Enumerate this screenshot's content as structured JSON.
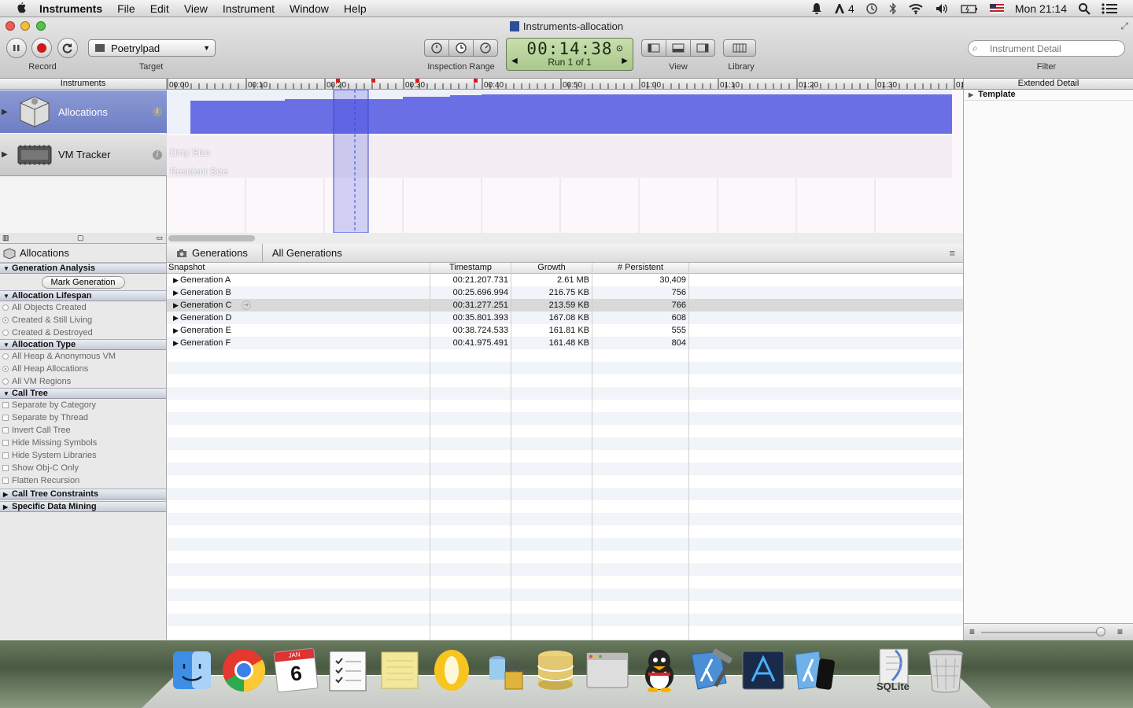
{
  "menubar": {
    "app_name": "Instruments",
    "items": [
      "File",
      "Edit",
      "View",
      "Instrument",
      "Window",
      "Help"
    ],
    "status_count": "4",
    "clock": "Mon 21:14"
  },
  "window": {
    "title": "Instruments-allocation",
    "toolbar": {
      "record_label": "Record",
      "target_label": "Target",
      "target_value": "Poetrylpad",
      "inspection_label": "Inspection Range",
      "timer": "00:14:38",
      "run": "Run 1 of 1",
      "view_label": "View",
      "library_label": "Library",
      "filter_placeholder": "Instrument Detail",
      "filter_label": "Filter"
    }
  },
  "instruments": {
    "header": "Instruments",
    "items": [
      {
        "name": "Allocations"
      },
      {
        "name": "VM Tracker"
      }
    ],
    "info_glyph": "i"
  },
  "timeline": {
    "ticks": [
      "00:00",
      "00:10",
      "00:20",
      "00:30",
      "00:40",
      "00:50",
      "01:00",
      "01:10",
      "01:20",
      "01:30",
      "01"
    ],
    "vm_labels": [
      "Dirty Size",
      "Resident Size"
    ]
  },
  "extended_detail": {
    "header": "Extended Detail",
    "template": "Template"
  },
  "left_panel": {
    "title": "Allocations",
    "sections": {
      "generation_analysis": "Generation Analysis",
      "mark_generation": "Mark Generation",
      "allocation_lifespan": "Allocation Lifespan",
      "lifespan_options": [
        "All Objects Created",
        "Created & Still Living",
        "Created & Destroyed"
      ],
      "allocation_type": "Allocation Type",
      "type_options": [
        "All Heap & Anonymous VM",
        "All Heap Allocations",
        "All VM Regions"
      ],
      "call_tree": "Call Tree",
      "call_tree_options": [
        "Separate by Category",
        "Separate by Thread",
        "Invert Call Tree",
        "Hide Missing Symbols",
        "Hide System Libraries",
        "Show Obj-C Only",
        "Flatten Recursion"
      ],
      "call_tree_constraints": "Call Tree Constraints",
      "specific_data_mining": "Specific Data Mining"
    }
  },
  "detail": {
    "breadcrumbs": [
      "Generations",
      "All Generations"
    ],
    "columns": [
      "Snapshot",
      "Timestamp",
      "Growth",
      "# Persistent"
    ],
    "rows": [
      {
        "snapshot": "Generation A",
        "timestamp": "00:21.207.731",
        "growth": "2.61 MB",
        "persistent": "30,409"
      },
      {
        "snapshot": "Generation B",
        "timestamp": "00:25.696.994",
        "growth": "216.75 KB",
        "persistent": "756"
      },
      {
        "snapshot": "Generation C",
        "timestamp": "00:31.277.251",
        "growth": "213.59 KB",
        "persistent": "766"
      },
      {
        "snapshot": "Generation D",
        "timestamp": "00:35.801.393",
        "growth": "167.08 KB",
        "persistent": "608"
      },
      {
        "snapshot": "Generation E",
        "timestamp": "00:38.724.533",
        "growth": "161.81 KB",
        "persistent": "555"
      },
      {
        "snapshot": "Generation F",
        "timestamp": "00:41.975.491",
        "growth": "161.48 KB",
        "persistent": "804"
      }
    ]
  },
  "dock": {
    "apps": [
      "finder",
      "chrome",
      "calendar",
      "reminders",
      "stickies",
      "opera",
      "keychain",
      "sequel",
      "browser",
      "qq",
      "xcode",
      "instruments",
      "app-store",
      "simulator",
      "sqlite",
      "trash"
    ],
    "calendar_month": "JAN",
    "calendar_day": "6",
    "sqlite_label": "SQLite"
  },
  "colors": {
    "selection": "#7b8ad0",
    "track_fill": "#6b6fe6",
    "lcd": "#b6d39a"
  }
}
